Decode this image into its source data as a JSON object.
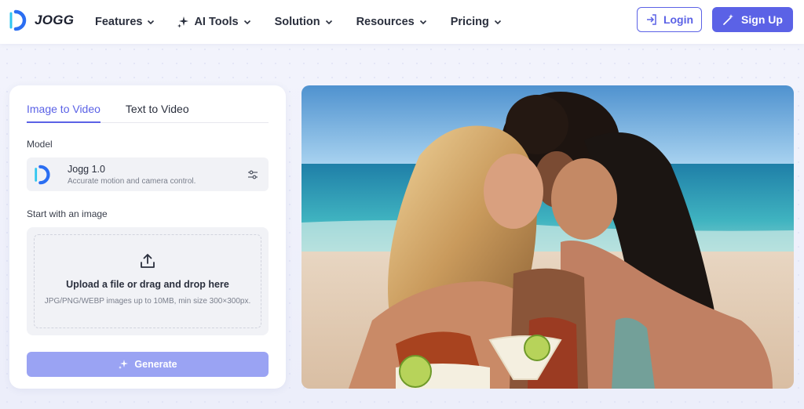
{
  "header": {
    "brand": "JOGG",
    "nav": [
      {
        "label": "Features",
        "icon": "chevron-down-icon"
      },
      {
        "label": "AI Tools",
        "icon": "sparkle-icon"
      },
      {
        "label": "Solution",
        "icon": "chevron-down-icon"
      },
      {
        "label": "Resources",
        "icon": "chevron-down-icon"
      },
      {
        "label": "Pricing",
        "icon": "chevron-down-icon"
      }
    ],
    "login_label": "Login",
    "signup_label": "Sign Up"
  },
  "panel": {
    "tabs": [
      "Image to Video",
      "Text to Video"
    ],
    "active_tab": "Image to Video",
    "model_label": "Model",
    "model": {
      "name": "Jogg 1.0",
      "description": "Accurate motion and camera control."
    },
    "start_label": "Start with an image",
    "upload": {
      "title": "Upload a file or drag and drop here",
      "hint": "JPG/PNG/WEBP images up to 10MB, min size 300×300px."
    },
    "generate_label": "Generate"
  },
  "colors": {
    "accent": "#5b62e6",
    "generate_disabled": "#9aa3f3",
    "background": "#eef0fb"
  }
}
